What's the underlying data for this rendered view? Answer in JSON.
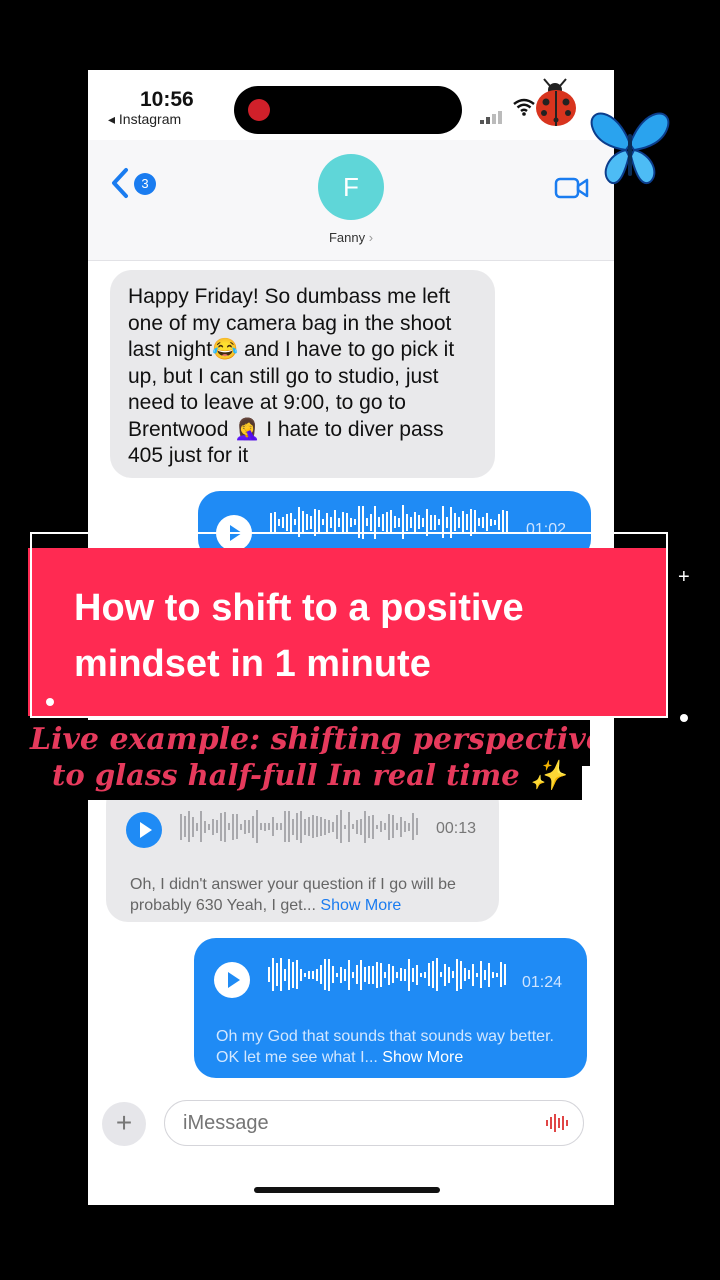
{
  "status_bar": {
    "time": "10:56",
    "back_app": "◂ Instagram"
  },
  "nav": {
    "back_badge": "3",
    "avatar_initial": "F",
    "contact_name": "Fanny",
    "contact_chevron": "›"
  },
  "messages": {
    "incoming_text": "Happy Friday! So dumbass me left one of my camera bag in the shoot last night😂 and I have to go pick it up, but I can still go to studio, just need to leave at 9:00, to go to Brentwood 🤦‍♀️ I hate to diver pass 405 just for it",
    "outgoing_audio_1": {
      "duration": "01:02"
    },
    "incoming_audio": {
      "duration": "00:13",
      "transcript": "Oh, I didn't answer your question if I go will be probably 630 Yeah, I get...",
      "show_more": "Show More"
    },
    "outgoing_audio_2": {
      "duration": "01:24",
      "transcript": "Oh my God that sounds that sounds way better. OK let me see what I...",
      "show_more": "Show More"
    }
  },
  "composer": {
    "plus": "+",
    "placeholder": "iMessage"
  },
  "overlay": {
    "title": "How to shift to a positive mindset in 1 minute",
    "subtitle_line1": "Live example: shifting perspective",
    "subtitle_line2": "to glass half-full In real time ✨",
    "accent_color": "#ff2a52",
    "subtitle_color": "#e63a5c"
  },
  "decorations": {
    "sticker_1": "ladybug-icon",
    "sticker_2": "butterfly-icon"
  }
}
